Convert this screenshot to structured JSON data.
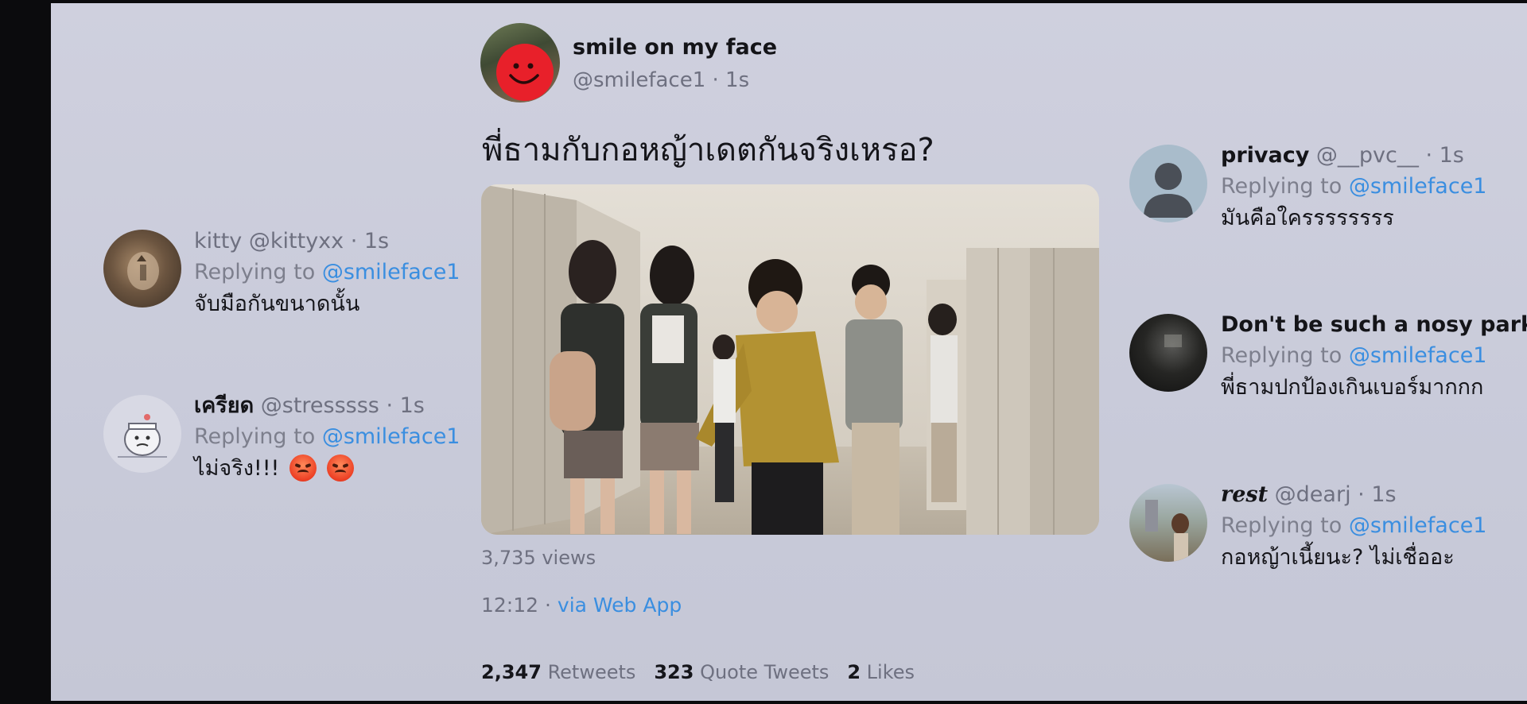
{
  "main_tweet": {
    "author_name": "smile on my face",
    "author_handle": "@smileface1 · 1s",
    "text": "พี่ธามกับกอหญ้าเดตกันจริงเหรอ?",
    "views": "3,735 views",
    "time": "12:12 ·",
    "via": "via Web App",
    "retweets_count": "2,347",
    "retweets_label": "Retweets",
    "quotes_count": "323",
    "quotes_label": "Quote Tweets",
    "likes_count": "2",
    "likes_label": "Likes",
    "image_icon": "school-hallway-photo"
  },
  "replying_prefix": "Replying to",
  "left_replies": [
    {
      "name": "kitty",
      "handle": "@kittyxx · 1s",
      "mention": "@smileface1",
      "text": "จับมือกันขนาดนั้น",
      "avatar_icon": "cat-avatar"
    },
    {
      "name": "เครียด",
      "handle": "@stresssss · 1s",
      "mention": "@smileface1",
      "text": "ไม่จริง!!!",
      "emoji_icon": "angry-face-emoji",
      "avatar_icon": "cartoon-avatar"
    }
  ],
  "right_replies": [
    {
      "name": "privacy",
      "handle": "@__pvc__ · 1s",
      "mention": "@smileface1",
      "text": "มันคือใครรรรรรรร",
      "avatar_icon": "default-person-icon"
    },
    {
      "name": "Don't be such a nosy parker",
      "mention": "@smileface1",
      "text": "พี่ธามปกป้องเกินเบอร์มากกก",
      "avatar_icon": "dark-avatar"
    },
    {
      "name": "rest",
      "handle": "@dearj · 1s",
      "mention": "@smileface1",
      "text": "กอหญ้าเนี้ยนะ? ไม่เชื่ออะ",
      "avatar_icon": "photo-avatar"
    }
  ],
  "colors": {
    "background": "#cdcfdd",
    "link": "#3a8ee0",
    "text": "#15151a",
    "muted": "#6e7080",
    "letterbox": "#0b0b0d"
  }
}
